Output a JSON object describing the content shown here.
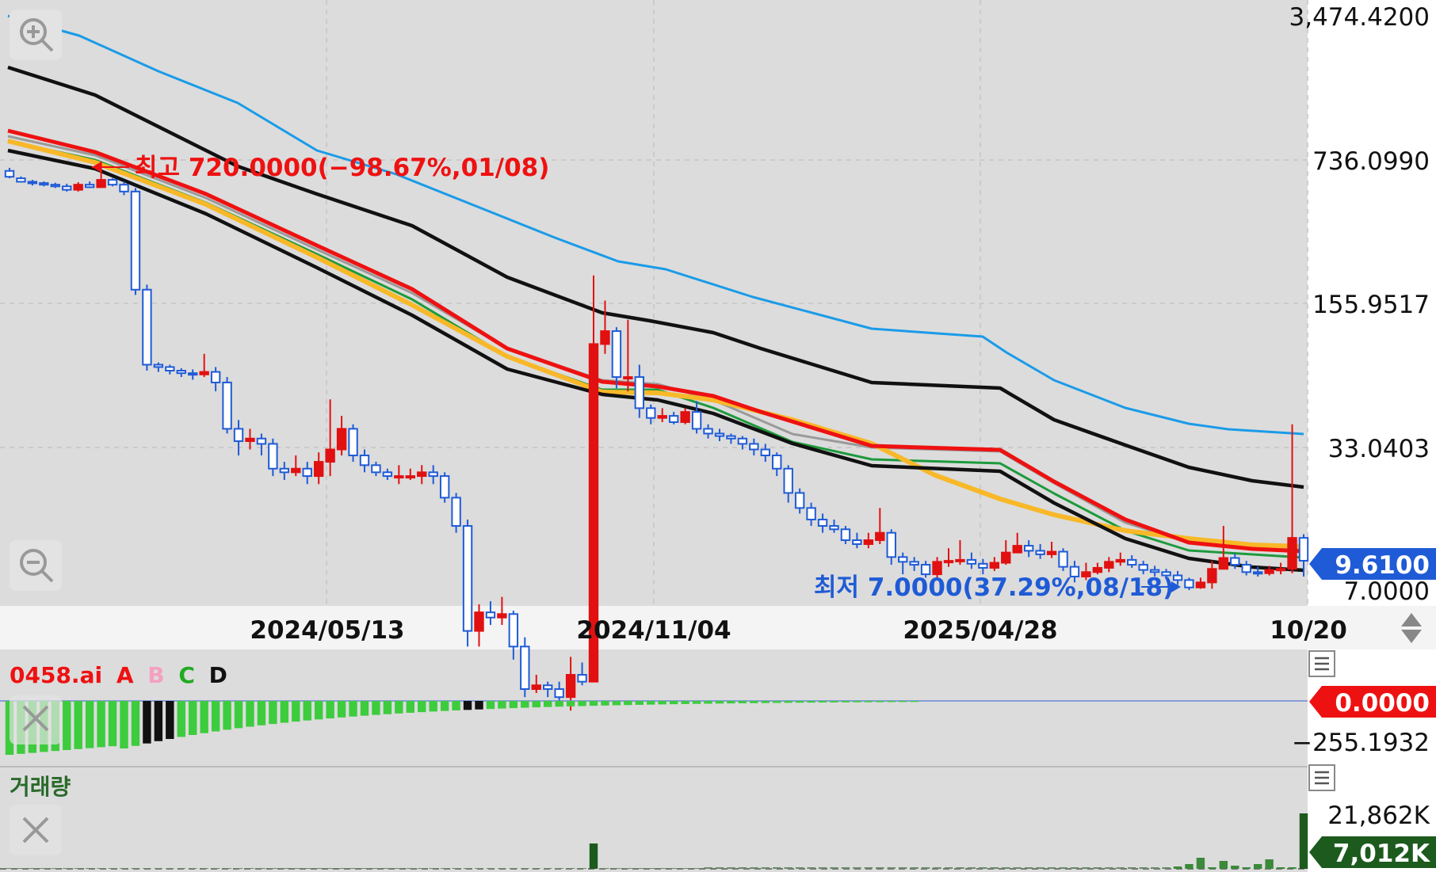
{
  "chart_data": {
    "type": "candlestick",
    "scale": "log",
    "y_ticks": [
      "3,474.4200",
      "736.0990",
      "155.9517",
      "33.0403",
      "7.0000"
    ],
    "x_ticks": [
      "2024/05/13",
      "2024/11/04",
      "2025/04/28",
      "10/20"
    ],
    "current_price": "9.6100",
    "high_annotation": "최고 720.0000(−98.67%,01/08)",
    "low_annotation": "최저 7.0000(37.29%,08/18)",
    "candles": [
      [
        650,
        610,
        672,
        600
      ],
      [
        600,
        578,
        612,
        575
      ],
      [
        578,
        570,
        590,
        555
      ],
      [
        570,
        560,
        580,
        550
      ],
      [
        560,
        550,
        572,
        540
      ],
      [
        550,
        530,
        566,
        520
      ],
      [
        530,
        560,
        575,
        520
      ],
      [
        560,
        545,
        580,
        540
      ],
      [
        545,
        590,
        720,
        540
      ],
      [
        590,
        560,
        600,
        550
      ],
      [
        560,
        520,
        580,
        500
      ],
      [
        520,
        180,
        540,
        170
      ],
      [
        180,
        80,
        190,
        75
      ],
      [
        80,
        78,
        82,
        74
      ],
      [
        78,
        75,
        80,
        72
      ],
      [
        75,
        73,
        77,
        70
      ],
      [
        73,
        72,
        76,
        68
      ],
      [
        72,
        74,
        90,
        70
      ],
      [
        74,
        66,
        78,
        60
      ],
      [
        66,
        40,
        70,
        38
      ],
      [
        40,
        35,
        44,
        30
      ],
      [
        35,
        36,
        40,
        32
      ],
      [
        36,
        34,
        38,
        30
      ],
      [
        34,
        26,
        36,
        24
      ],
      [
        26,
        25,
        28,
        23
      ],
      [
        25,
        26,
        30,
        24
      ],
      [
        26,
        24,
        28,
        22
      ],
      [
        24,
        28,
        31,
        22
      ],
      [
        28,
        32,
        55,
        24
      ],
      [
        32,
        40,
        46,
        30
      ],
      [
        40,
        30,
        42,
        28
      ],
      [
        30,
        27,
        32,
        25
      ],
      [
        27,
        25,
        28,
        24
      ],
      [
        25,
        24,
        26,
        23
      ],
      [
        24,
        24,
        27,
        22
      ],
      [
        24,
        24,
        26,
        23
      ],
      [
        24,
        25,
        27,
        22
      ],
      [
        25,
        24,
        27,
        22
      ],
      [
        24,
        19,
        25,
        18
      ],
      [
        19,
        14,
        20,
        13
      ],
      [
        14,
        4.5,
        15,
        3.8
      ],
      [
        4.5,
        5.5,
        6,
        3.8
      ],
      [
        5.5,
        5.2,
        6.2,
        4.8
      ],
      [
        5.2,
        5.4,
        6.5,
        4.8
      ],
      [
        5.4,
        3.8,
        5.6,
        3.3
      ],
      [
        3.8,
        2.4,
        4.2,
        2.2
      ],
      [
        2.4,
        2.5,
        2.8,
        2.3
      ],
      [
        2.5,
        2.4,
        2.6,
        2.2
      ],
      [
        2.4,
        2.2,
        2.6,
        2.1
      ],
      [
        2.2,
        2.8,
        3.4,
        1.9
      ],
      [
        2.8,
        2.6,
        3.2,
        2.5
      ],
      [
        2.6,
        100,
        210,
        4.2
      ],
      [
        100,
        115,
        160,
        90
      ],
      [
        115,
        70,
        120,
        62
      ],
      [
        70,
        70,
        130,
        60
      ],
      [
        70,
        50,
        80,
        45
      ],
      [
        50,
        45,
        52,
        42
      ],
      [
        45,
        46,
        50,
        43
      ],
      [
        46,
        43,
        48,
        42
      ],
      [
        43,
        48,
        50,
        42
      ],
      [
        48,
        40,
        54,
        38
      ],
      [
        40,
        38,
        42,
        36
      ],
      [
        38,
        37,
        40,
        35
      ],
      [
        37,
        36,
        38,
        34
      ],
      [
        36,
        34,
        37,
        32
      ],
      [
        34,
        32,
        36,
        30
      ],
      [
        32,
        30,
        34,
        28
      ],
      [
        30,
        26,
        31,
        24
      ],
      [
        26,
        20,
        27,
        18
      ],
      [
        20,
        17,
        21,
        16
      ],
      [
        17,
        15,
        18,
        14
      ],
      [
        15,
        14,
        16,
        13
      ],
      [
        14,
        13.5,
        15,
        13
      ],
      [
        13.5,
        12,
        14,
        11.5
      ],
      [
        12,
        11.5,
        13,
        11
      ],
      [
        11.5,
        12,
        13,
        11
      ],
      [
        12,
        13,
        17,
        11.5
      ],
      [
        13,
        10,
        13.5,
        9.2
      ],
      [
        10,
        9.5,
        10.5,
        8.3
      ],
      [
        9.5,
        9.2,
        10,
        8.6
      ],
      [
        9.2,
        8.3,
        9.6,
        8
      ],
      [
        8.3,
        9.5,
        10,
        8
      ],
      [
        9.5,
        9.6,
        11,
        9
      ],
      [
        9.6,
        9.7,
        12,
        9.2
      ],
      [
        9.7,
        9.3,
        10.5,
        8.8
      ],
      [
        9.3,
        8.9,
        9.8,
        8.3
      ],
      [
        8.9,
        9.4,
        10,
        8.6
      ],
      [
        9.4,
        10.5,
        12,
        9.2
      ],
      [
        10.5,
        11.3,
        13,
        10.5
      ],
      [
        11.3,
        10.7,
        12,
        10
      ],
      [
        10.7,
        10.3,
        11.5,
        9.8
      ],
      [
        10.3,
        10.6,
        11.8,
        9.9
      ],
      [
        10.6,
        9,
        11,
        8.6
      ],
      [
        9,
        8.1,
        9.6,
        7.6
      ],
      [
        8.1,
        8.5,
        9.4,
        7.8
      ],
      [
        8.5,
        8.9,
        9.4,
        8.3
      ],
      [
        8.9,
        9.5,
        10,
        8.5
      ],
      [
        9.5,
        9.7,
        10.5,
        9.1
      ],
      [
        9.7,
        9.2,
        10.2,
        8.9
      ],
      [
        9.2,
        8.7,
        9.6,
        8.3
      ],
      [
        8.7,
        8.5,
        9.1,
        8.1
      ],
      [
        8.5,
        8.2,
        8.8,
        7.9
      ],
      [
        8.2,
        7.8,
        8.6,
        7.4
      ],
      [
        7.8,
        7.2,
        8,
        7
      ],
      [
        7.2,
        7.6,
        8,
        7.1
      ],
      [
        7.6,
        8.8,
        9.6,
        7.1
      ],
      [
        8.8,
        9.9,
        14,
        9.5
      ],
      [
        9.9,
        9.2,
        10.4,
        8.8
      ],
      [
        9.2,
        8.5,
        9.6,
        8.2
      ],
      [
        8.5,
        8.4,
        9,
        8.1
      ],
      [
        8.4,
        8.7,
        9.1,
        8.2
      ],
      [
        8.7,
        8.8,
        9.4,
        8.3
      ],
      [
        8.8,
        12.3,
        42,
        8.4
      ],
      [
        12.3,
        9.61,
        12.8,
        8.1
      ]
    ],
    "indicator": {
      "name": "0458.ai",
      "legend": [
        "A",
        "B",
        "C",
        "D"
      ],
      "legend_colors": [
        "#ee1111",
        "#f4a0c0",
        "#22aa22",
        "#111111"
      ],
      "value_label": "0.0000",
      "min_label": "−255.1932"
    },
    "volume": {
      "title": "거래량",
      "max_label": "21,862K",
      "current_label": "7,012K"
    }
  }
}
